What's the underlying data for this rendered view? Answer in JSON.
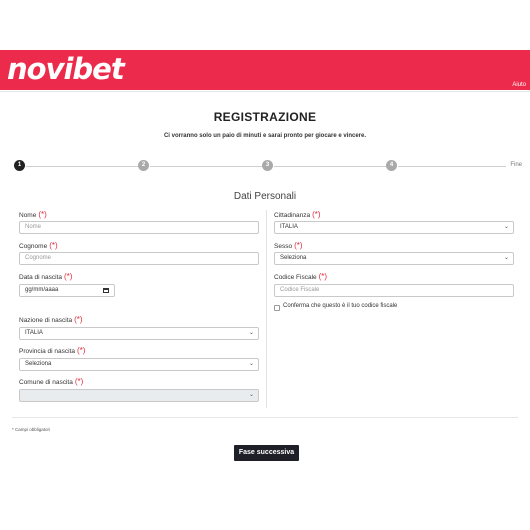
{
  "header": {
    "logo": "novibet",
    "help": "Aiuto"
  },
  "page": {
    "title": "REGISTRAZIONE",
    "subtitle": "Ci vorranno solo un paio di minuti e sarai pronto per giocare e vincere.",
    "section_title": "Dati Personali"
  },
  "stepper": {
    "steps": [
      "1",
      "2",
      "3",
      "4"
    ],
    "end_label": "Fine",
    "active_step": 1
  },
  "form": {
    "required_marker": "(*)",
    "left": {
      "nome": {
        "label": "Nome",
        "placeholder": "Nome"
      },
      "cognome": {
        "label": "Cognome",
        "placeholder": "Cognome"
      },
      "data_nascita": {
        "label": "Data di nascita",
        "placeholder": "gg/mm/aaaa"
      },
      "nazione_nascita": {
        "label": "Nazione di nascita",
        "value": "ITALIA"
      },
      "provincia_nascita": {
        "label": "Provincia di nascita",
        "value": "Seleziona"
      },
      "comune_nascita": {
        "label": "Comune di nascita",
        "value": ""
      }
    },
    "right": {
      "cittadinanza": {
        "label": "Cittadinanza",
        "value": "ITALIA"
      },
      "sesso": {
        "label": "Sesso",
        "value": "Seleziona"
      },
      "codice_fiscale": {
        "label": "Codice Fiscale",
        "placeholder": "Codice Fiscale"
      },
      "conferma": {
        "label": "Conferma che questo è il tuo codice fiscale"
      }
    }
  },
  "footer": {
    "required_note": "* Campi obbligatori",
    "next_button": "Fase successiva"
  },
  "colors": {
    "brand": "#ec2a4b",
    "required": "#e02b3c",
    "button": "#1f2027",
    "active_step": "#222222",
    "inactive_step": "#a9a9a9"
  },
  "icons": {
    "select_caret": "chevron-down-icon",
    "date_picker": "calendar-icon"
  }
}
